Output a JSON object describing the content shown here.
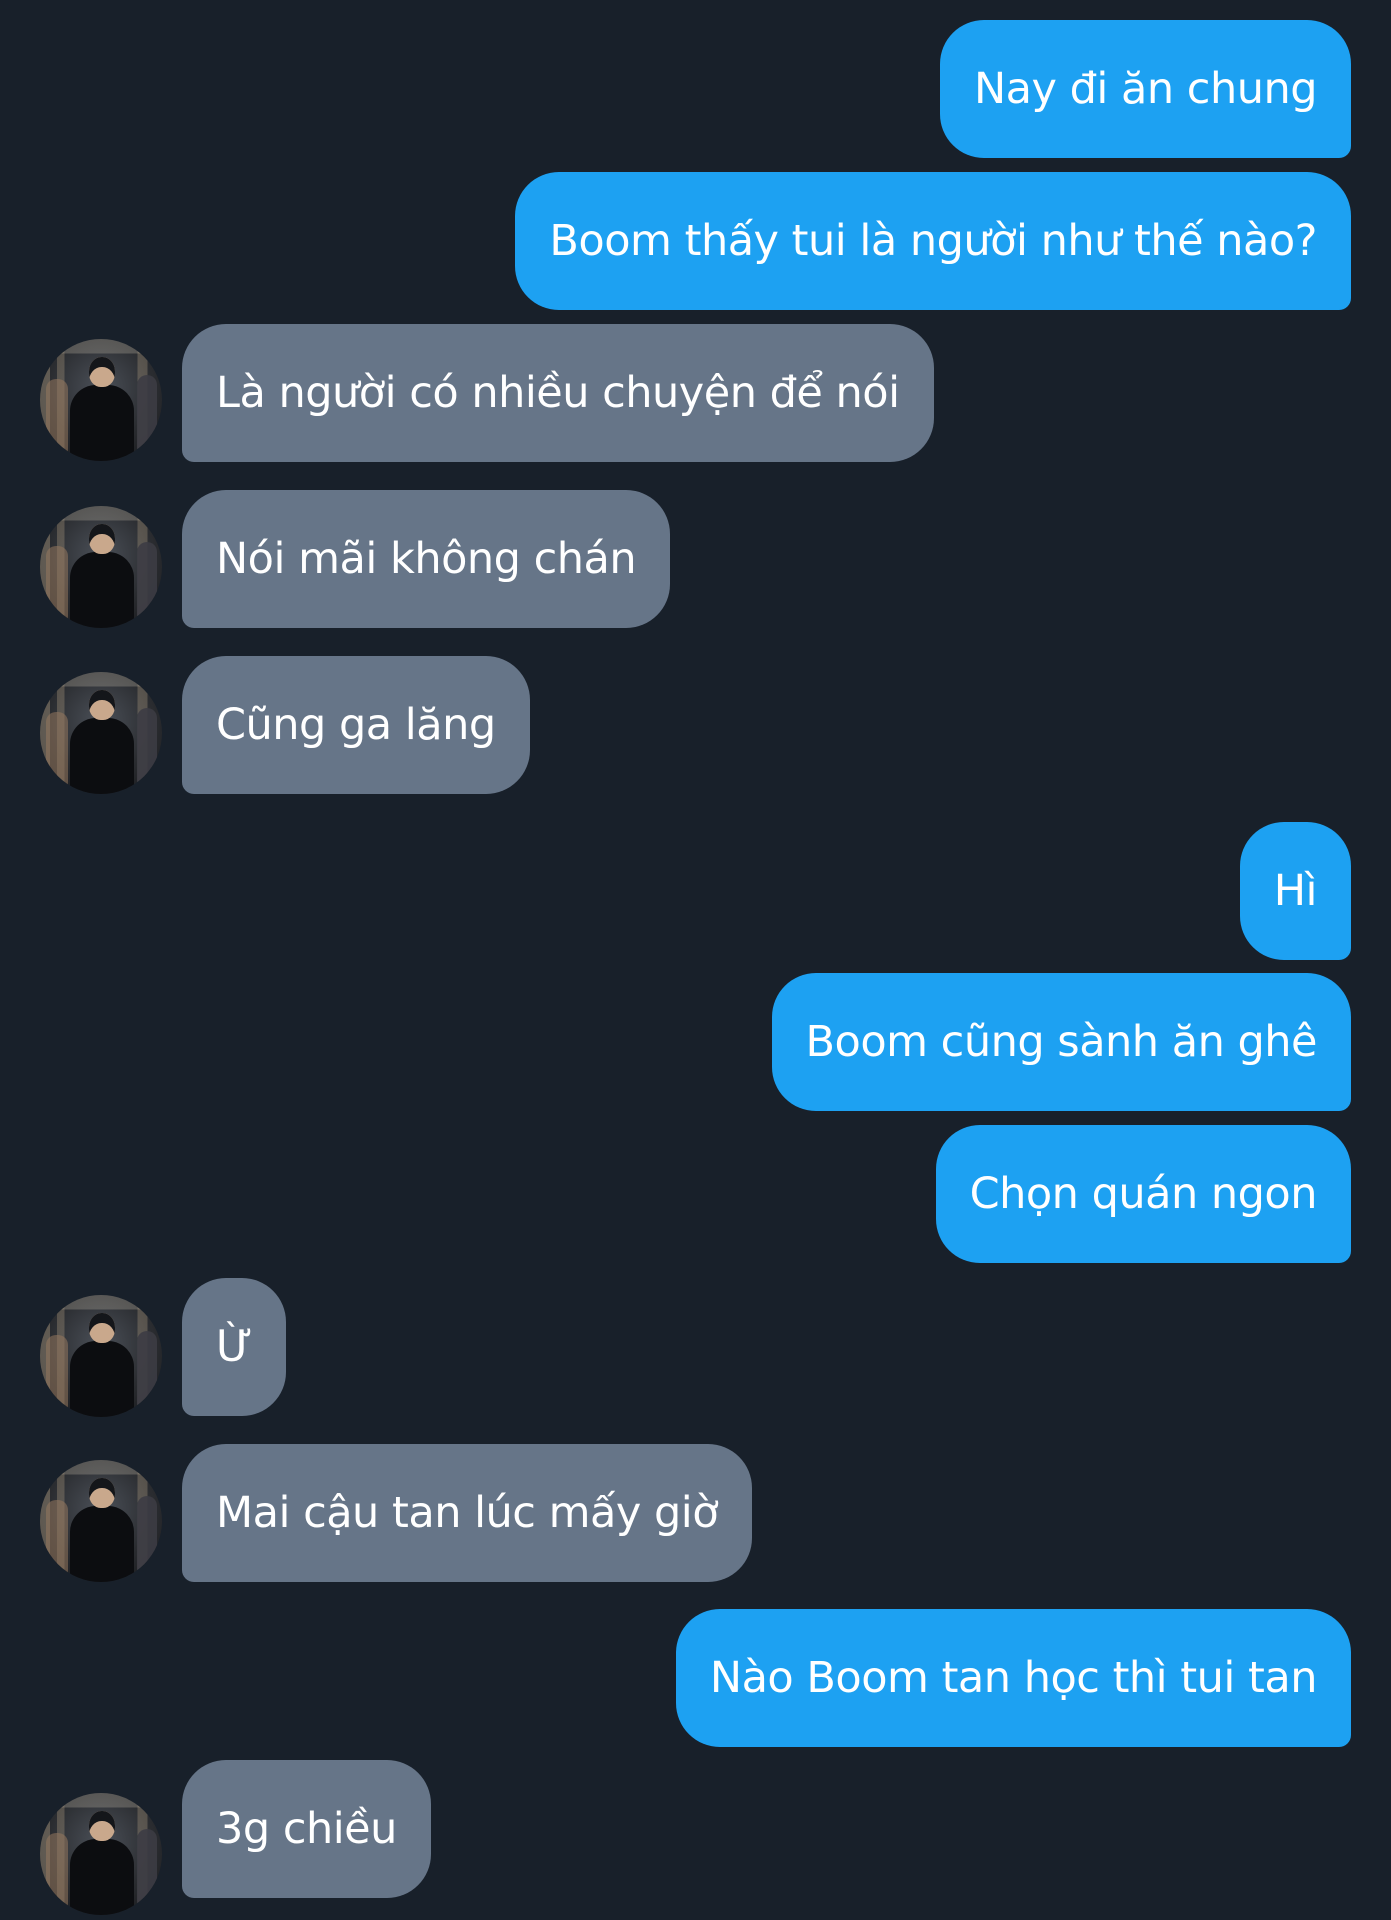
{
  "chat": {
    "messages": [
      {
        "direction": "out",
        "text": "Nay đi ăn chung"
      },
      {
        "direction": "out",
        "text": "Boom thấy tui là người như thế nào?"
      },
      {
        "direction": "in",
        "text": "Là người có nhiều chuyện để nói"
      },
      {
        "direction": "in",
        "text": "Nói mãi không chán"
      },
      {
        "direction": "in",
        "text": "Cũng ga lăng"
      },
      {
        "direction": "out",
        "text": "Hì"
      },
      {
        "direction": "out",
        "text": "Boom cũng sành ăn ghê"
      },
      {
        "direction": "out",
        "text": "Chọn quán ngon"
      },
      {
        "direction": "in",
        "text": "Ừ"
      },
      {
        "direction": "in",
        "text": "Mai cậu tan lúc mấy giờ"
      },
      {
        "direction": "out",
        "text": "Nào Boom tan học thì tui tan"
      },
      {
        "direction": "in",
        "text": "3g chiều"
      }
    ]
  },
  "colors": {
    "background": "#18202a",
    "outgoing_bubble": "#1da1f2",
    "incoming_bubble": "#667588",
    "text": "#ffffff"
  },
  "icons": {
    "avatar": "contact-avatar-photo"
  }
}
